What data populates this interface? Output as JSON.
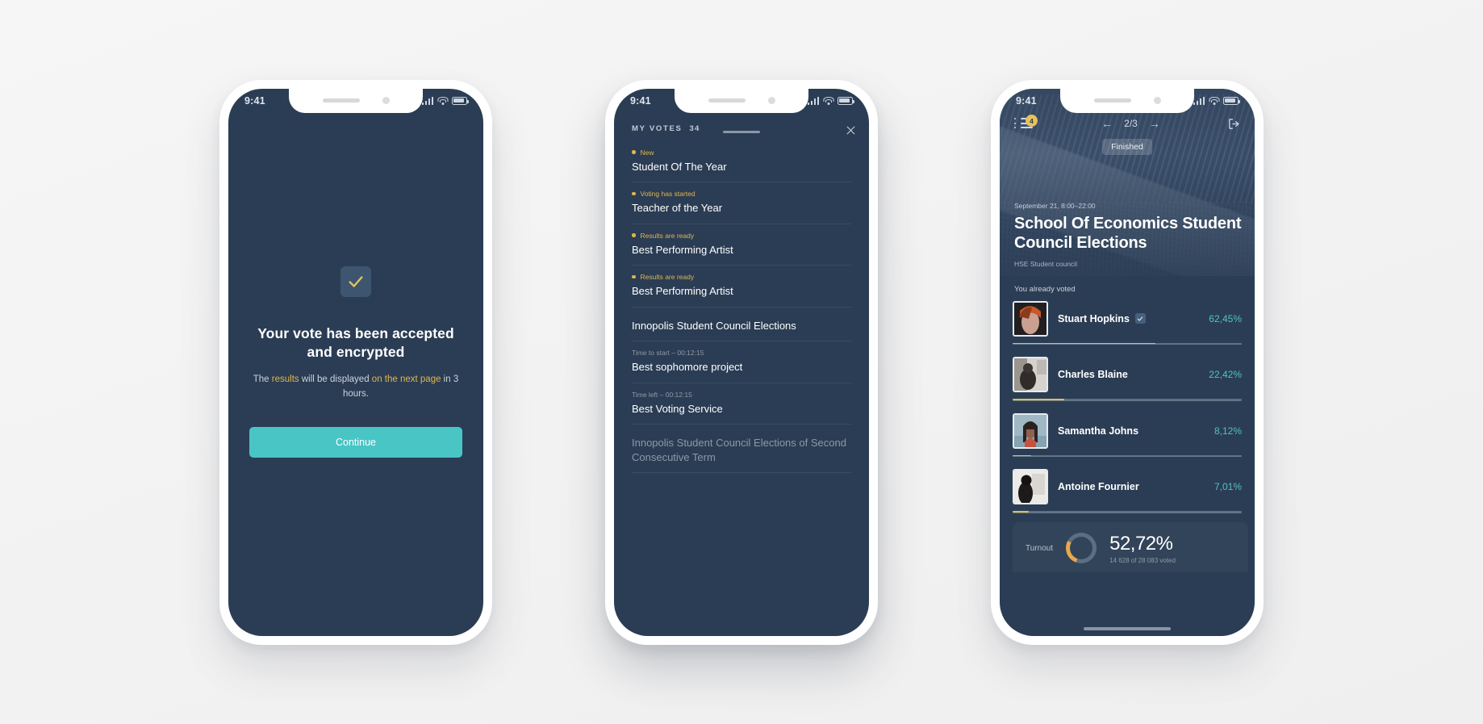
{
  "status_bar": {
    "time": "9:41"
  },
  "screen_accepted": {
    "icon": "check-icon",
    "title": "Your vote has been accepted and encrypted",
    "sub_prefix": "The ",
    "sub_hl1": "results",
    "sub_mid": " will be displayed ",
    "sub_hl2": "on the next page",
    "sub_suffix": " in 3 hours.",
    "continue_label": "Continue",
    "accent_button": "#49c5c5",
    "accent_gold": "#e0b54e"
  },
  "screen_my_votes": {
    "header_label": "MY VOTES",
    "header_count": "34",
    "close_icon": "close-icon",
    "items": [
      {
        "tag": "New",
        "timer": "",
        "title": "Student Of The Year",
        "muted": false
      },
      {
        "tag": "Voting has started",
        "timer": "",
        "title": "Teacher of the Year",
        "muted": false
      },
      {
        "tag": "Results are ready",
        "timer": "",
        "title": "Best Performing Artist",
        "muted": false
      },
      {
        "tag": "Results are ready",
        "timer": "",
        "title": "Best Performing Artist",
        "muted": false
      },
      {
        "tag": "",
        "timer": "",
        "title": "Innopolis Student Council Elections",
        "muted": false
      },
      {
        "tag": "",
        "timer": "Time to start – 00:12:15",
        "title": "Best sophomore project",
        "muted": false
      },
      {
        "tag": "",
        "timer": "Time left – 00:12:15",
        "title": "Best Voting Service",
        "muted": false
      },
      {
        "tag": "",
        "timer": "",
        "title": "Innopolis Student Council Elections of Second Consecutive Term",
        "muted": true
      }
    ]
  },
  "screen_results": {
    "menu_icon": "list-menu-icon",
    "menu_badge": "4",
    "pager_prev": "←",
    "pager_position": "2/3",
    "pager_next": "→",
    "exit_icon": "logout-icon",
    "status_chip": "Finished",
    "date": "September 21, 8:00–22:00",
    "title": "School Of Economics Student Council Elections",
    "organizer": "HSE Student council",
    "voted_note": "You already voted",
    "candidates": [
      {
        "name": "Stuart Hopkins",
        "percent": "62,45%",
        "value": 62.45,
        "voted": true
      },
      {
        "name": "Charles Blaine",
        "percent": "22,42%",
        "value": 22.42,
        "voted": false
      },
      {
        "name": "Samantha Johns",
        "percent": "8,12%",
        "value": 8.12,
        "voted": false
      },
      {
        "name": "Antoine Fournier",
        "percent": "7,01%",
        "value": 7.01,
        "voted": false
      }
    ],
    "turnout_label": "Turnout",
    "turnout_value": "52,72%",
    "turnout_sub": "14 628 of 28 083 voted",
    "accent_teal": "#4fc3c3",
    "accent_gold": "#ddbd5c"
  }
}
